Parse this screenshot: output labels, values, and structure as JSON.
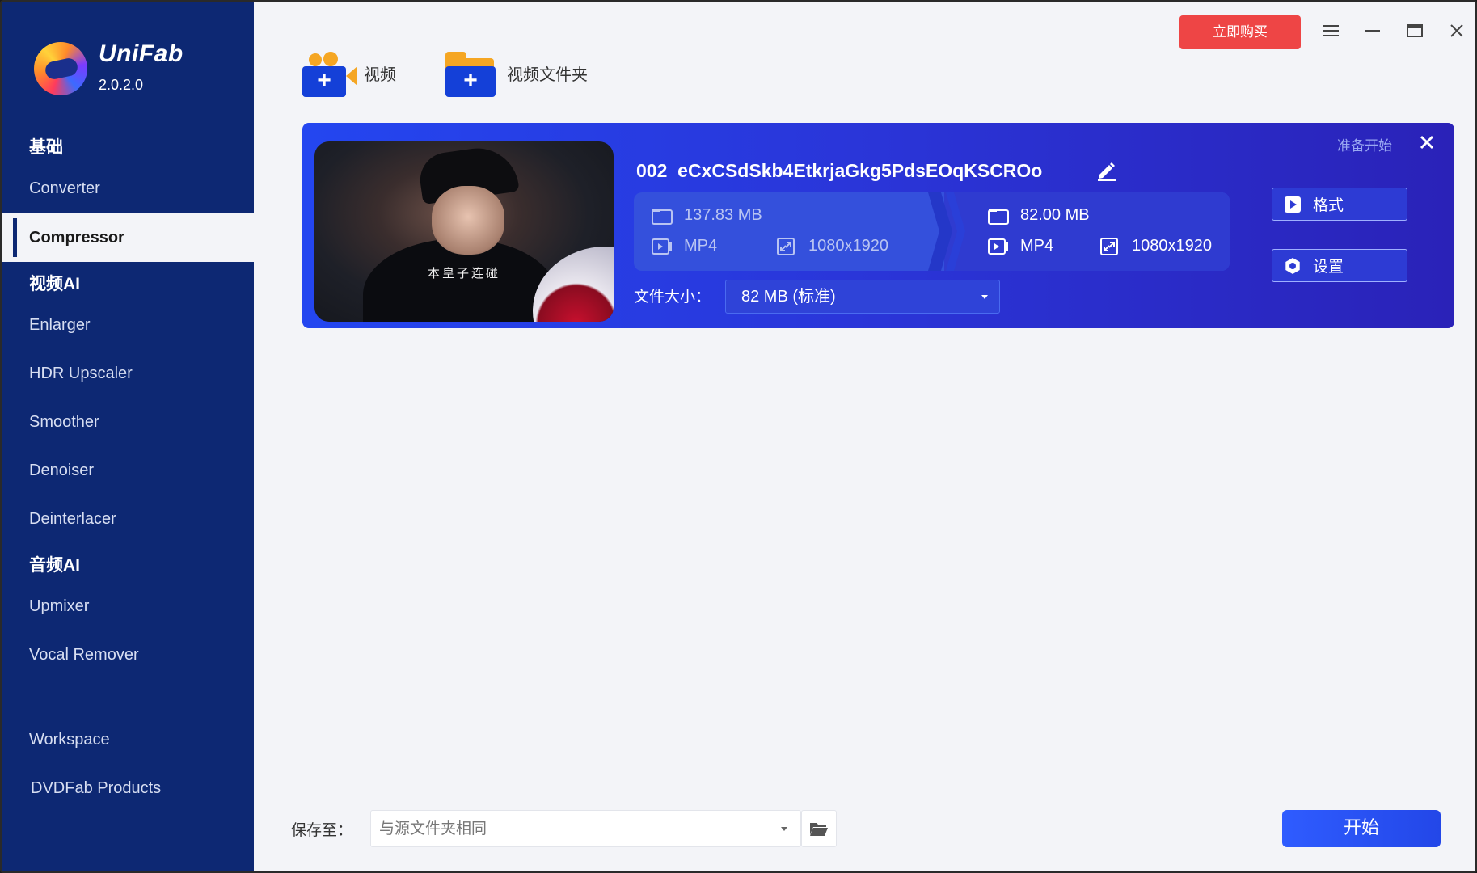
{
  "app": {
    "name": "UniFab",
    "version": "2.0.2.0"
  },
  "sidebar": {
    "sections": [
      {
        "title": "基础",
        "items": [
          "Converter",
          "Compressor"
        ]
      },
      {
        "title": "视频AI",
        "items": [
          "Enlarger",
          "HDR Upscaler",
          "Smoother",
          "Denoiser",
          "Deinterlacer"
        ]
      },
      {
        "title": "音频AI",
        "items": [
          "Upmixer",
          "Vocal Remover"
        ]
      }
    ],
    "footer_items": [
      "Workspace",
      "DVDFab Products"
    ],
    "active_item": "Compressor"
  },
  "topbar": {
    "buy_label": "立即购买",
    "add_video_label": "视频",
    "add_folder_label": "视频文件夹"
  },
  "task": {
    "file_name": "002_eCxCSdSkb4EtkrjaGkg5PdsEOqKSCROo",
    "status": "准备开始",
    "thumbnail_caption": "本皇子连碰",
    "source": {
      "size": "137.83 MB",
      "format": "MP4",
      "resolution": "1080x1920"
    },
    "output": {
      "size": "82.00 MB",
      "format": "MP4",
      "resolution": "1080x1920"
    },
    "size_label": "文件大小：",
    "size_option": "82 MB (标准)",
    "format_button": "格式",
    "settings_button": "设置"
  },
  "bottom": {
    "save_label": "保存至：",
    "save_path": "与源文件夹相同",
    "start_label": "开始"
  },
  "colors": {
    "sidebar_bg": "#0d2873",
    "buy_button": "#ee4545",
    "card_gradient_start": "#2446f0",
    "card_gradient_end": "#2a22b8",
    "start_button": "#2f5cff"
  }
}
